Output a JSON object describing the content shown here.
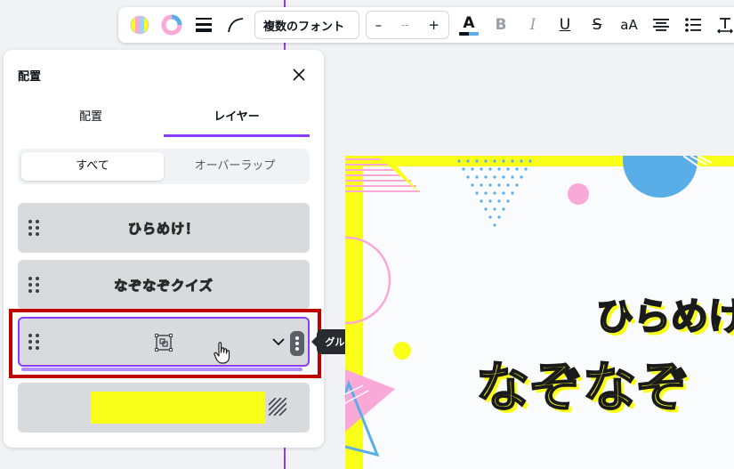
{
  "toolbar": {
    "font_name": "複数のフォント",
    "size_minus": "–",
    "size_value": "--",
    "size_plus": "+",
    "text_color_glyph": "A",
    "bold_glyph": "B",
    "italic_glyph": "I",
    "underline_glyph": "U",
    "strike_glyph": "S",
    "case_glyph": "aA",
    "icons": [
      "color-palette-icon",
      "color-ring-icon",
      "line-weight-icon",
      "curve-icon",
      "align-center-icon",
      "bulleted-list-icon",
      "text-spacing-icon"
    ]
  },
  "panel": {
    "title": "配置",
    "tabs": [
      {
        "label": "配置",
        "active": false
      },
      {
        "label": "レイヤー",
        "active": true
      }
    ],
    "segments": [
      {
        "label": "すべて",
        "active": true
      },
      {
        "label": "オーバーラップ",
        "active": false
      }
    ],
    "layers": [
      {
        "label": "ひらめけ！"
      },
      {
        "label": "なぞなぞクイズ"
      },
      {
        "label": "",
        "type": "group"
      },
      {
        "label": "",
        "type": "background-rect"
      }
    ],
    "tooltip": "グループ"
  },
  "canvas": {
    "line1": "ひらめけ",
    "line2": "なぞなぞ"
  },
  "colors": {
    "accent": "#8b3dff",
    "highlight_border": "#c00000",
    "yellow": "#f9ff18",
    "pink": "#f9a8d8",
    "blue": "#5aaee8"
  }
}
